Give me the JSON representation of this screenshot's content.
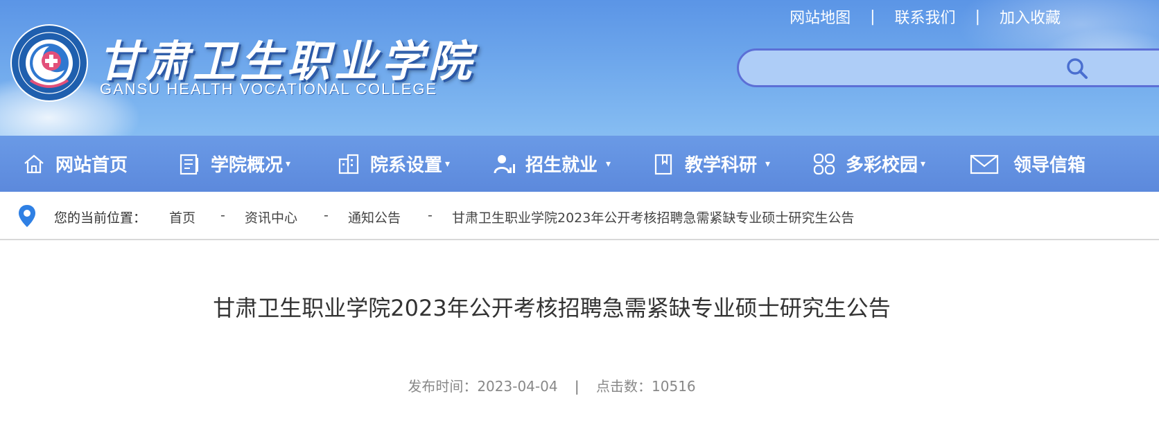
{
  "header": {
    "college_name_cn": "甘肃卫生职业学院",
    "college_name_en": "GANSU HEALTH VOCATIONAL COLLEGE",
    "top_links": [
      "网站地图",
      "联系我们",
      "加入收藏"
    ],
    "top_link_separator": "|",
    "search": {
      "placeholder": "",
      "value": ""
    }
  },
  "nav": {
    "items": [
      {
        "label": "网站首页",
        "icon": "home-icon",
        "has_dropdown": false
      },
      {
        "label": "学院概况",
        "icon": "document-icon",
        "has_dropdown": true
      },
      {
        "label": "院系设置",
        "icon": "building-icon",
        "has_dropdown": true
      },
      {
        "label": "招生就业",
        "icon": "person-chart-icon",
        "has_dropdown": true
      },
      {
        "label": "教学科研",
        "icon": "book-icon",
        "has_dropdown": true
      },
      {
        "label": "多彩校园",
        "icon": "grid-icon",
        "has_dropdown": true
      },
      {
        "label": "领导信箱",
        "icon": "mail-icon",
        "has_dropdown": false
      }
    ],
    "caret": "▾"
  },
  "breadcrumb": {
    "prefix": "您的当前位置：",
    "items": [
      "首页",
      "资讯中心",
      "通知公告",
      "甘肃卫生职业学院2023年公开考核招聘急需紧缺专业硕士研究生公告"
    ],
    "separator": "-"
  },
  "article": {
    "title": "甘肃卫生职业学院2023年公开考核招聘急需紧缺专业硕士研究生公告",
    "publish_label": "发布时间：",
    "publish_date": "2023-04-04",
    "meta_separator": "|",
    "views_label": "点击数：",
    "views": "10516"
  },
  "colors": {
    "header_blue": "#5b95e6",
    "nav_blue": "#6a9ae6",
    "search_border": "#5c6fd6",
    "pin_blue": "#2f80e4",
    "logo_pink": "#e2507a"
  }
}
